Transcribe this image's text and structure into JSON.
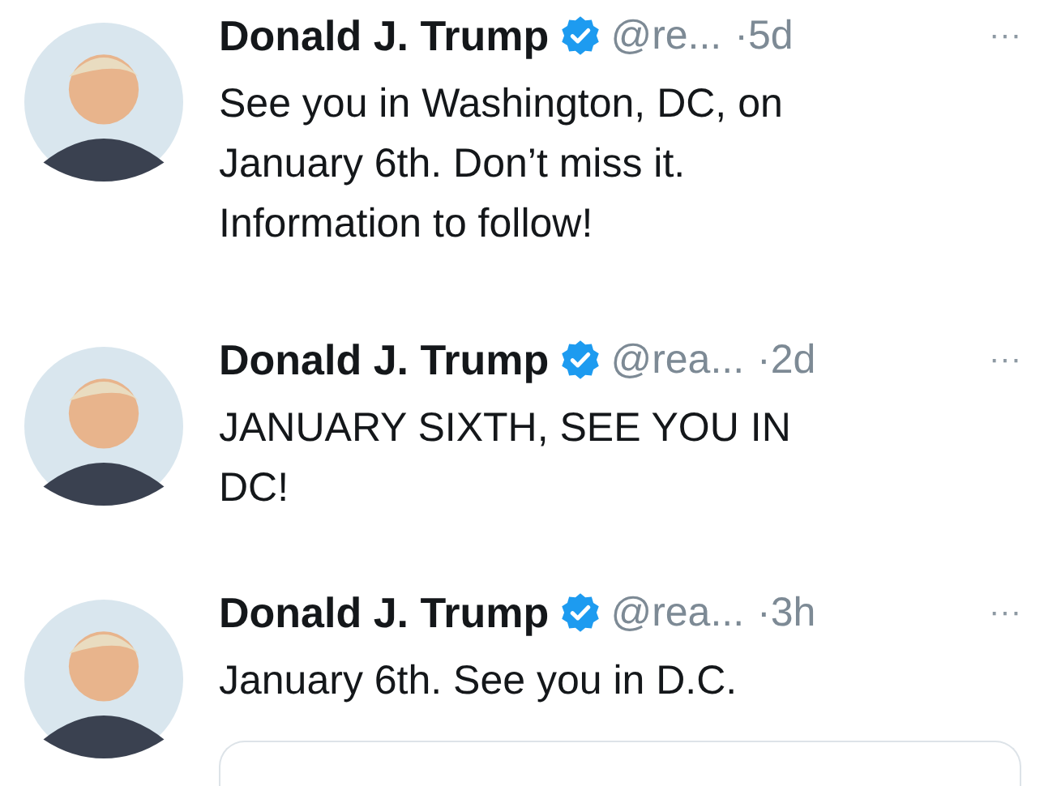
{
  "tweets": [
    {
      "name": "Donald J. Trump",
      "verified": true,
      "handle": "@re...",
      "time": "·5d",
      "more": "···",
      "lines": [
        "See you in Washington, DC, on",
        "January 6th. Don’t miss it.",
        "Information to follow!"
      ],
      "card": false
    },
    {
      "name": "Donald J. Trump",
      "verified": true,
      "handle": "@rea...",
      "time": "·2d",
      "more": "···",
      "lines": [
        "JANUARY SIXTH, SEE YOU IN",
        "DC!"
      ],
      "card": false
    },
    {
      "name": "Donald J. Trump",
      "verified": true,
      "handle": "@rea...",
      "time": "·3h",
      "more": "···",
      "lines": [
        "January 6th. See you in D.C."
      ],
      "card": true
    }
  ]
}
